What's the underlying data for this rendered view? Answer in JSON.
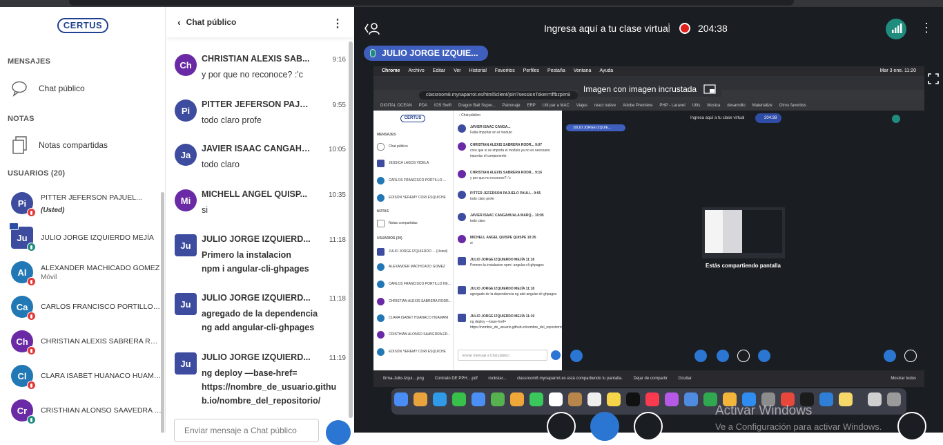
{
  "sidebar": {
    "logo": "CERTUS",
    "messages_title": "MENSAJES",
    "public_chat_label": "Chat público",
    "notes_title": "NOTAS",
    "shared_notes_label": "Notas compartidas",
    "users_title": "USUARIOS (20)",
    "users": [
      {
        "initials": "Pi",
        "name": "PITTER JEFERSON PAJUEL...",
        "tag": "(Usted)",
        "sub": "",
        "color": "#3d4c9e"
      },
      {
        "initials": "Ju",
        "name": "JULIO JORGE IZQUIERDO MEJÍA",
        "tag": "",
        "sub": "",
        "color": "#3d4c9e"
      },
      {
        "initials": "Al",
        "name": "ALEXANDER MACHICADO GOMEZ",
        "tag": "",
        "sub": "Móvil",
        "color": "#2278b5"
      },
      {
        "initials": "Ca",
        "name": "CARLOS FRANCISCO PORTILLO HE...",
        "tag": "",
        "sub": "",
        "color": "#2278b5"
      },
      {
        "initials": "Ch",
        "name": "CHRISTIAN ALEXIS SABRERA RODR...",
        "tag": "",
        "sub": "",
        "color": "#6a2aa5"
      },
      {
        "initials": "Cl",
        "name": "CLARA ISABET HUANACO HUAMANI",
        "tag": "",
        "sub": "",
        "color": "#2278b5"
      },
      {
        "initials": "Cr",
        "name": "CRISTHIAN ALONSO SAAVEDRA ER...",
        "tag": "",
        "sub": "",
        "color": "#6a2aa5"
      }
    ]
  },
  "chat": {
    "title": "Chat público",
    "input_placeholder": "Enviar mensaje a Chat público",
    "messages": [
      {
        "initials": "Ch",
        "name": "CHRISTIAN ALEXIS SAB...",
        "time": "9:16",
        "text": "y por que no reconoce? :'c",
        "bold": false,
        "color": "#6a2aa5"
      },
      {
        "initials": "Pi",
        "name": "PITTER JEFERSON PAJU...",
        "time": "9:55",
        "text": "todo claro profe",
        "bold": false,
        "color": "#3d4c9e"
      },
      {
        "initials": "Ja",
        "name": "JAVIER ISAAC CANGAHU...",
        "time": "10:05",
        "text": "todo claro",
        "bold": false,
        "color": "#3d4c9e"
      },
      {
        "initials": "Mi",
        "name": "MICHELL ANGEL QUISP...",
        "time": "10:35",
        "text": "si",
        "bold": false,
        "color": "#6a2aa5"
      },
      {
        "initials": "Ju",
        "name": "JULIO JORGE IZQUIERD...",
        "time": "11:18",
        "text": "Primero la instalacion\nnpm i angular-cli-ghpages",
        "bold": true,
        "color": "#3d4c9e"
      },
      {
        "initials": "Ju",
        "name": "JULIO JORGE IZQUIERD...",
        "time": "11:18",
        "text": "agregado de la dependencia\nng add angular-cli-ghpages",
        "bold": true,
        "color": "#3d4c9e"
      },
      {
        "initials": "Ju",
        "name": "JULIO JORGE IZQUIERD...",
        "time": "11:19",
        "text": "ng deploy —base-href=\nhttps://nombre_de_usuario.githu\nb.io/nombre_del_repositorio/",
        "bold": true,
        "color": "#3d4c9e"
      }
    ]
  },
  "main": {
    "title": "Ingresa aquí a tu clase virtual",
    "timer": "204:38",
    "presenter": "JULIO JORGE IZQUIE...",
    "pip_label": "Imagen con imagen incrustada",
    "url": "classroom8.mynaparrot.es/html5client/join?sessionToken=iffbzpim9",
    "menubar": [
      "Chrome",
      "Archivo",
      "Editar",
      "Ver",
      "Historial",
      "Favoritos",
      "Perfiles",
      "Pestaña",
      "Ventana",
      "Ayuda"
    ],
    "mac_time": "Mar 3 ene.  11:20",
    "bookmarks": [
      "DIGITAL OCEAN",
      "PDA",
      "IOS Swift",
      "Dragon Ball Super...",
      "Patronaje",
      "ERP",
      "Util par a MAC",
      "Viajes",
      "react native",
      "Adobe Premiere",
      "PHP - Laravel",
      "Utils",
      "Musica",
      "desarrollo",
      "Materialize",
      "Otros favoritos"
    ],
    "inner_title": "Ingresa aquí a tu clase virtual",
    "inner_timer": "204:38",
    "inner_presenter": "JULIO JORGE IZQUIE...",
    "sharing_label": "Estás compartiendo pantalla",
    "share_notice": "classroom8.mynaparrot.es está compartiendo tu pantalla.",
    "stop_share": "Dejar de compartir",
    "hide": "Ocultar",
    "downloads": [
      "firma-Julio-Izqui....png",
      "Contrato DE PPH....pdf",
      "rockstar..."
    ],
    "show_all": "Mostrar todos",
    "inner_chat_title": "Chat público",
    "inner_input": "Enviar mensaje a Chat público",
    "inner_sections": {
      "messages": "MENSAJES",
      "notes": "NOTAS",
      "users": "USUARIOS (20)"
    },
    "inner_sidebar_items": [
      "Chat público",
      "JESSICA LAGOS VIDELA",
      "CARLOS FRANCISCO PORTILLO ...",
      "EDISON YEREMY CORI ESQUICHE",
      "Notas compartidas"
    ],
    "inner_users": [
      "JULIO JORGE IZQUIERDO ... (Usted)",
      "ALEXANDER MACHICADO GOMEZ",
      "CARLOS FRANCISCO PORTILLO HE...",
      "CHRISTIAN ALEXIS SABRERA RODR...",
      "CLARA ISABET HUANACO HUAMANI",
      "CRISTHIAN ALONSO SAAVEDRA ER...",
      "EDISON YEREMY CORI ESQUICHE"
    ],
    "inner_messages": [
      {
        "name": "JAVIER ISAAC CANGA...",
        "text": "Falta importar en el modulo"
      },
      {
        "name": "CHRISTIAN ALEXIS SABRERA RODR...  9:07",
        "text": "creo que si se importa el modulo ya no es necesario importar el componente"
      },
      {
        "name": "CHRISTIAN ALEXIS SABRERA RODR...  9:16",
        "text": "y por que no reconoce? :'c"
      },
      {
        "name": "PITTER JEFERSON PAJUELO PAULI...  9:55",
        "text": "todo claro profe"
      },
      {
        "name": "JAVIER ISAAC CANGAHUALA MARQ...  10:05",
        "text": "todo claro"
      },
      {
        "name": "MICHELL ANGEL QUISPE QUISPE  10:35",
        "text": "si"
      },
      {
        "name": "JULIO JORGE IZQUIERDO MEJÍA  11:18",
        "text": "Primero la instalacion npm i angular-cli-ghpages"
      },
      {
        "name": "JULIO JORGE IZQUIERDO MEJÍA  11:18",
        "text": "agregado de la dependencia ng add angular-cli-ghpages"
      },
      {
        "name": "JULIO JORGE IZQUIERDO MEJÍA  11:19",
        "text": "ng deploy —base-href= https://nombre_de_usuario.github.io/nombre_del_repositorio/"
      }
    ],
    "watermark_title": "Activar Windows",
    "watermark_sub": "Ve a Configuración para activar Windows."
  },
  "colors": {
    "accent": "#3f5fbf",
    "record": "#e0201c",
    "teal": "#1f8c7e",
    "mic_off": "#e03a3a"
  }
}
